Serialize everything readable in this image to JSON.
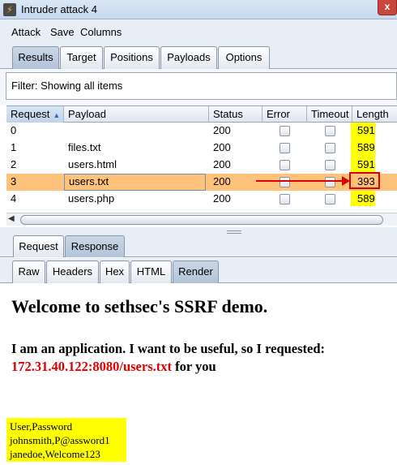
{
  "window": {
    "title": "Intruder attack 4",
    "close_glyph": "x"
  },
  "menu": [
    "Attack",
    "Save",
    "Columns"
  ],
  "main_tabs": [
    "Results",
    "Target",
    "Positions",
    "Payloads",
    "Options"
  ],
  "filter": {
    "text": "Filter: Showing all items"
  },
  "table": {
    "columns": [
      "Request",
      "Payload",
      "Status",
      "Error",
      "Timeout",
      "Length"
    ],
    "rows": [
      {
        "request": "0",
        "payload": "",
        "status": "200",
        "error": false,
        "timeout": false,
        "length": "591"
      },
      {
        "request": "1",
        "payload": "files.txt",
        "status": "200",
        "error": false,
        "timeout": false,
        "length": "589"
      },
      {
        "request": "2",
        "payload": "users.html",
        "status": "200",
        "error": false,
        "timeout": false,
        "length": "591"
      },
      {
        "request": "3",
        "payload": "users.txt",
        "status": "200",
        "error": false,
        "timeout": false,
        "length": "393"
      },
      {
        "request": "4",
        "payload": "users.php",
        "status": "200",
        "error": false,
        "timeout": false,
        "length": "589"
      }
    ],
    "selected_row": "3"
  },
  "reqresp_tabs": [
    "Request",
    "Response"
  ],
  "view_tabs": [
    "Raw",
    "Headers",
    "Hex",
    "HTML",
    "Render"
  ],
  "render": {
    "heading": "Welcome to sethsec's SSRF demo.",
    "line1": "I am an application. I want to be useful, so I requested:",
    "url": "172.31.40.122:8080/users.txt",
    "line2_suffix": " for you",
    "file_lines": [
      "User,Password",
      "johnsmith,P@assword1",
      "janedoe,Welcome123"
    ]
  },
  "colors": {
    "highlight_yellow": "#ffff00",
    "selected_row": "#ffc27a",
    "annotation_red": "#e00000"
  }
}
